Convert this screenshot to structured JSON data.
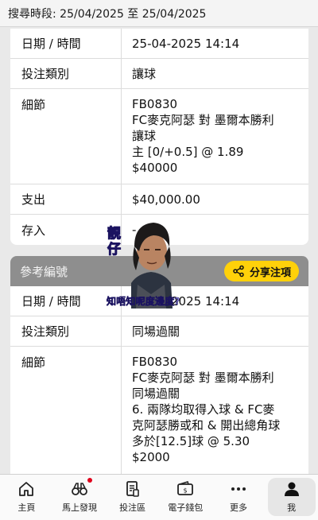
{
  "search": {
    "text": "搜尋時段: 25/04/2025 至 25/04/2025"
  },
  "card1": {
    "rows": [
      {
        "label": "日期 / 時間",
        "value": "25-04-2025 14:14"
      },
      {
        "label": "投注類別",
        "value": "讓球"
      },
      {
        "label": "細節",
        "lines": [
          "FB0830",
          "FC麥克阿瑟 對 墨爾本勝利",
          "讓球",
          "主 [0/+0.5] @ 1.89",
          "$40000"
        ]
      },
      {
        "label": "支出",
        "value": "$40,000.00"
      },
      {
        "label": "存入",
        "value": "-"
      }
    ]
  },
  "card2": {
    "header": "參考編號",
    "share_label": "分享注項",
    "rows": [
      {
        "label": "日期 / 時間",
        "value": "25-04-2025 14:14"
      },
      {
        "label": "投注類別",
        "value": "同場過關"
      },
      {
        "label": "細節",
        "lines": [
          "FB0830",
          "FC麥克阿瑟 對 墨爾本勝利",
          "同場過關",
          "6. 兩隊均取得入球 & FC麥",
          "克阿瑟勝或和 & 開出總角球",
          "多於[12.5]球 @ 5.30",
          "$2000"
        ]
      }
    ]
  },
  "overlay": {
    "vertical_text": "靚仔",
    "caption": "知唔知呢度邊度?"
  },
  "tabbar": {
    "items": [
      {
        "label": "主頁",
        "icon": "home-icon"
      },
      {
        "label": "馬上發現",
        "icon": "binoculars-icon"
      },
      {
        "label": "投注區",
        "icon": "betslip-icon"
      },
      {
        "label": "電子錢包",
        "icon": "wallet-icon"
      },
      {
        "label": "更多",
        "icon": "more-icon"
      },
      {
        "label": "我",
        "icon": "profile-icon"
      }
    ],
    "active_index": 5
  },
  "colors": {
    "accent": "#ffd10a",
    "header_gray": "#8e8e8e",
    "dot_red": "#e0001b"
  }
}
